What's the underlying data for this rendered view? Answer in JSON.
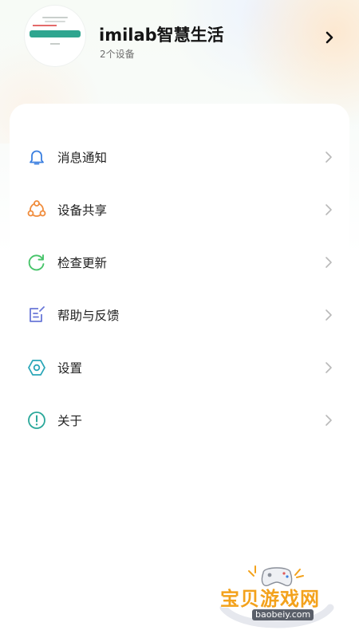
{
  "header": {
    "title": "imilab智慧生活",
    "device_count": "2个设备",
    "arrow_icon": "chevron-right-icon"
  },
  "menu": {
    "items": [
      {
        "label": "消息通知",
        "icon": "bell-icon",
        "color": "#3b7fe0"
      },
      {
        "label": "设备共享",
        "icon": "share-icon",
        "color": "#f08c3c"
      },
      {
        "label": "检查更新",
        "icon": "refresh-icon",
        "color": "#47c46a"
      },
      {
        "label": "帮助与反馈",
        "icon": "feedback-icon",
        "color": "#6a78d8"
      },
      {
        "label": "设置",
        "icon": "settings-icon",
        "color": "#2aa6b8"
      },
      {
        "label": "关于",
        "icon": "info-icon",
        "color": "#2aa89a"
      }
    ]
  },
  "watermark": {
    "text": "宝贝游戏网",
    "url": "baobeiy.com"
  }
}
